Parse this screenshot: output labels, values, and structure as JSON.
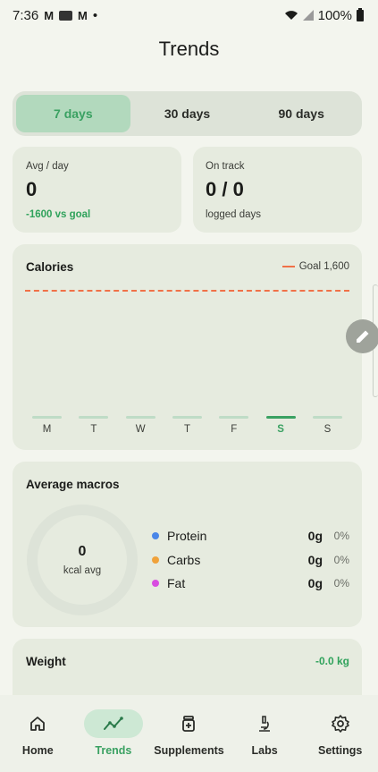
{
  "status_bar": {
    "time": "7:36",
    "dot": "•",
    "battery": "100%",
    "icons": [
      "gmail-icon",
      "screen-icon",
      "gmail-icon",
      "wifi-icon",
      "signal-icon",
      "battery-icon"
    ]
  },
  "page": {
    "title": "Trends"
  },
  "range_tabs": [
    {
      "label": "7 days",
      "active": true
    },
    {
      "label": "30 days",
      "active": false
    },
    {
      "label": "90 days",
      "active": false
    }
  ],
  "stats": {
    "avg": {
      "label": "Avg / day",
      "value": "0",
      "sub": "-1600 vs goal"
    },
    "on_track": {
      "label": "On track",
      "value": "0 / 0",
      "sub": "logged days"
    }
  },
  "calories": {
    "title": "Calories",
    "legend": "Goal 1,600",
    "goal_color": "#f07148",
    "bar_color": "#bfdcc6",
    "today_color": "#3aa162"
  },
  "chart_data": {
    "type": "bar",
    "categories": [
      "M",
      "T",
      "W",
      "T",
      "F",
      "S",
      "S"
    ],
    "values": [
      0,
      0,
      0,
      0,
      0,
      0,
      0
    ],
    "goal": 1600,
    "highlight_index": 5
  },
  "macros": {
    "title": "Average macros",
    "center_value": "0",
    "center_label": "kcal avg",
    "items": [
      {
        "name": "Protein",
        "grams": "0g",
        "pct": "0%",
        "color": "#4a86e8"
      },
      {
        "name": "Carbs",
        "grams": "0g",
        "pct": "0%",
        "color": "#f0a23b"
      },
      {
        "name": "Fat",
        "grams": "0g",
        "pct": "0%",
        "color": "#d84ce0"
      }
    ]
  },
  "weight": {
    "title": "Weight",
    "value": "-0.0 kg"
  },
  "nav": [
    {
      "label": "Home",
      "icon": "home-icon",
      "active": false
    },
    {
      "label": "Trends",
      "icon": "trends-icon",
      "active": true
    },
    {
      "label": "Supplements",
      "icon": "supplements-icon",
      "active": false
    },
    {
      "label": "Labs",
      "icon": "microscope-icon",
      "active": false
    },
    {
      "label": "Settings",
      "icon": "gear-icon",
      "active": false
    }
  ],
  "accent": "#3aa162"
}
